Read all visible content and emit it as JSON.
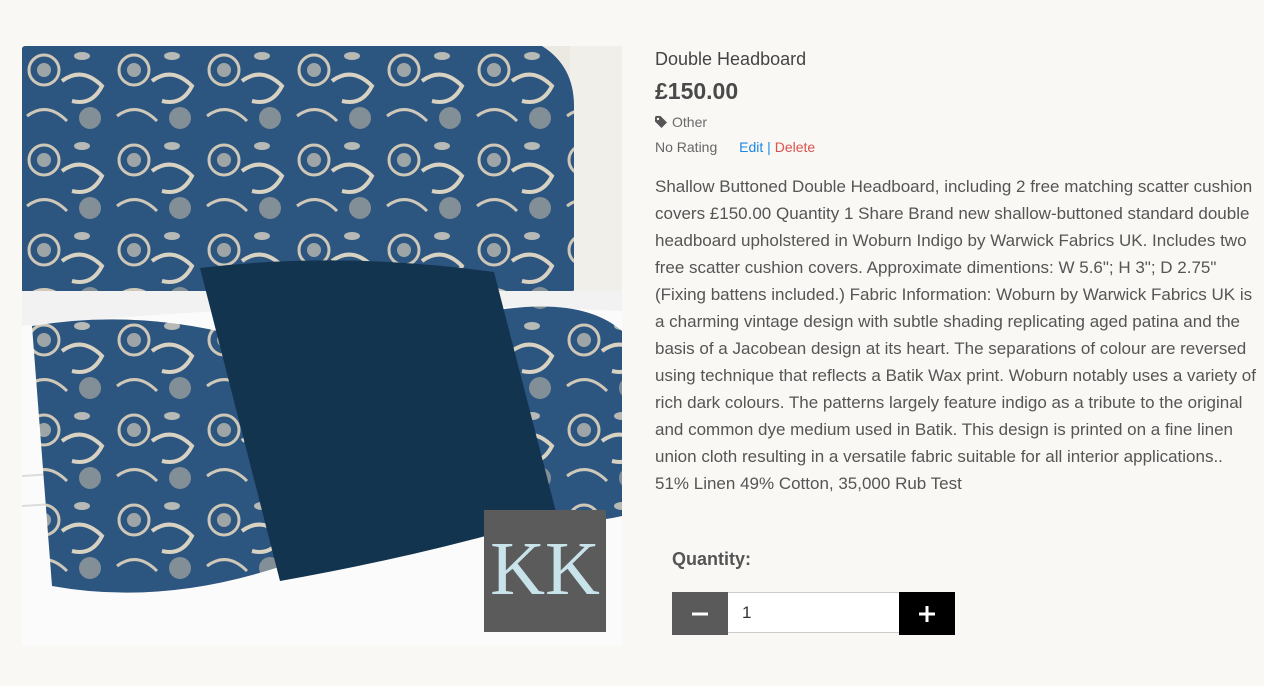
{
  "product": {
    "title": "Double Headboard",
    "price": "£150.00",
    "category": "Other",
    "rating": "No Rating",
    "edit_label": "Edit",
    "separator": "|",
    "delete_label": "Delete",
    "description": "Shallow Buttoned Double Headboard, including 2 free matching scatter cushion covers £150.00 Quantity 1 Share Brand new shallow-buttoned standard double headboard upholstered in Woburn Indigo by Warwick Fabrics UK. Includes two free scatter cushion covers. Approximate dimentions: W 5.6\"; H 3\"; D 2.75\" (Fixing battens included.) Fabric Information: Woburn by Warwick Fabrics UK is a charming vintage design with subtle shading replicating aged patina and the basis of a Jacobean design at its heart. The separations of colour are reversed using technique that reflects a Batik Wax print. Woburn notably uses a variety of rich dark colours. The patterns largely feature indigo as a tribute to the original and common dye medium used in Batik. This design is printed on a fine linen union cloth resulting in a versatile fabric suitable for all interior applications.. 51% Linen 49% Cotton, 35,000 Rub Test",
    "image_logo_text": "KK"
  },
  "quantity": {
    "label": "Quantity:",
    "value": "1",
    "minus_icon": "minus-icon",
    "plus_icon": "plus-icon"
  },
  "colors": {
    "background": "#f9f8f4",
    "edit_link": "#1e88e5",
    "delete_link": "#d9534f",
    "minus_button": "#5a5a5a",
    "plus_button": "#000000"
  }
}
